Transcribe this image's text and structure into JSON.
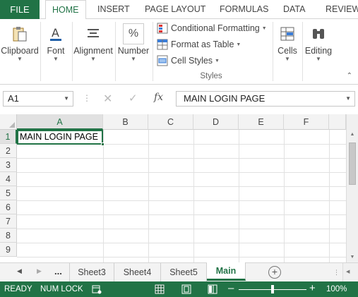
{
  "ribbon_tabs": [
    "FILE",
    "HOME",
    "INSERT",
    "PAGE LAYOUT",
    "FORMULAS",
    "DATA",
    "REVIEW"
  ],
  "ribbon": {
    "clipboard": "Clipboard",
    "font": "Font",
    "alignment": "Alignment",
    "number": "Number",
    "number_icon": "%",
    "conditional_formatting": "Conditional Formatting",
    "format_as_table": "Format as Table",
    "cell_styles": "Cell Styles",
    "styles_group": "Styles",
    "cells": "Cells",
    "editing": "Editing"
  },
  "formula_bar": {
    "name_box": "A1",
    "fx": "fx",
    "content": "MAIN LOGIN PAGE"
  },
  "grid": {
    "columns": [
      "A",
      "B",
      "C",
      "D",
      "E",
      "F"
    ],
    "rows": [
      "1",
      "2",
      "3",
      "4",
      "5",
      "6",
      "7",
      "8",
      "9"
    ],
    "a1": "MAIN LOGIN PAGE"
  },
  "sheets": {
    "ellipsis": "...",
    "tabs": [
      "Sheet3",
      "Sheet4",
      "Sheet5",
      "Main"
    ],
    "active": "Main"
  },
  "status": {
    "ready": "READY",
    "num_lock": "NUM LOCK",
    "zoom": "100%",
    "zoom_fraction": 0.5
  },
  "colors": {
    "accent": "#217346"
  }
}
